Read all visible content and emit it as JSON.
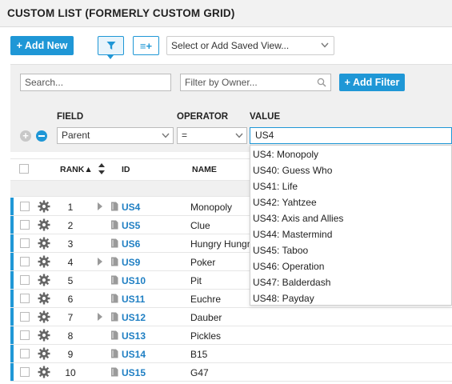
{
  "title": "CUSTOM LIST (FORMERLY CUSTOM GRID)",
  "toolbar": {
    "add_new_label": "+ Add New",
    "columns_icon_text": "≡+",
    "saved_view_placeholder": "Select or Add Saved View..."
  },
  "filter": {
    "search_placeholder": "Search...",
    "owner_placeholder": "Filter by Owner...",
    "add_filter_label": "+ Add Filter",
    "field_header": "FIELD",
    "operator_header": "OPERATOR",
    "value_header": "VALUE",
    "field_value": "Parent",
    "operator_value": "=",
    "value_text": "US4"
  },
  "grid": {
    "headers": {
      "rank": "RANK",
      "rank_arrow": "▲",
      "id": "ID",
      "name": "NAME"
    },
    "rows": [
      {
        "rank": "1",
        "id": "US4",
        "name": "Monopoly",
        "has_children": true
      },
      {
        "rank": "2",
        "id": "US5",
        "name": "Clue",
        "has_children": false
      },
      {
        "rank": "3",
        "id": "US6",
        "name": "Hungry Hungry",
        "has_children": false
      },
      {
        "rank": "4",
        "id": "US9",
        "name": "Poker",
        "has_children": true
      },
      {
        "rank": "5",
        "id": "US10",
        "name": "Pit",
        "has_children": false
      },
      {
        "rank": "6",
        "id": "US11",
        "name": "Euchre",
        "has_children": false
      },
      {
        "rank": "7",
        "id": "US12",
        "name": "Dauber",
        "has_children": true
      },
      {
        "rank": "8",
        "id": "US13",
        "name": "Pickles",
        "has_children": false
      },
      {
        "rank": "9",
        "id": "US14",
        "name": "B15",
        "has_children": false
      },
      {
        "rank": "10",
        "id": "US15",
        "name": "G47",
        "has_children": false
      }
    ]
  },
  "suggestions": [
    "US4: Monopoly",
    "US40: Guess Who",
    "US41: Life",
    "US42: Yahtzee",
    "US43: Axis and Allies",
    "US44: Mastermind",
    "US45: Taboo",
    "US46: Operation",
    "US47: Balderdash",
    "US48: Payday"
  ],
  "colors": {
    "accent": "#1f97d6",
    "link": "#1f7fc3",
    "panel": "#f0f0f0"
  }
}
